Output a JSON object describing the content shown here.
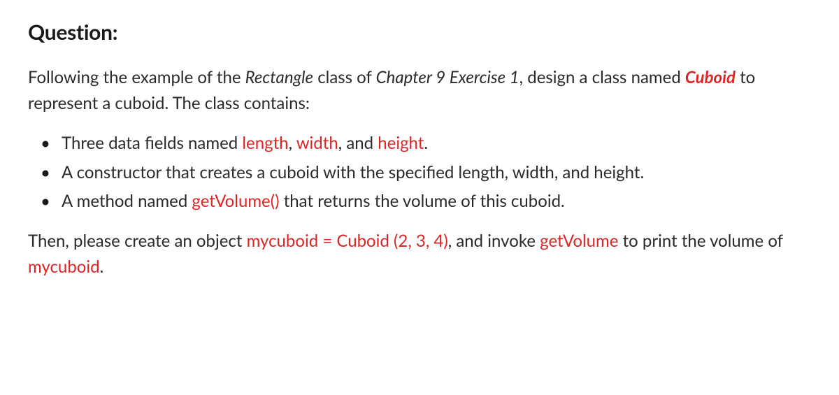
{
  "heading": "Question:",
  "intro": {
    "p1": "Following the example of the ",
    "rect": "Rectangle",
    "p2": " class of ",
    "chap": "Chapter 9 Exercise 1",
    "p3": ", design a class named ",
    "cuboid": "Cuboid",
    "p4": " to represent a cuboid. The class contains:"
  },
  "bullets": {
    "b1": {
      "t1": "Three data fields named ",
      "len": "length",
      "t2": ", ",
      "wid": "width",
      "t3": ", and ",
      "hei": "height",
      "t4": "."
    },
    "b2": {
      "t1": "A constructor that creates a cuboid with the specified length, width, and height."
    },
    "b3": {
      "t1": "A method named ",
      "gv": "getVolume()",
      "t2": " that returns the volume of this cuboid."
    }
  },
  "outro": {
    "t1": "Then, please create an object ",
    "obj": "mycuboid = Cuboid (2, 3, 4)",
    "t2": ", and invoke ",
    "gv": "getVolume",
    "t3": " to print the volume of ",
    "mc": "mycuboid",
    "t4": "."
  }
}
